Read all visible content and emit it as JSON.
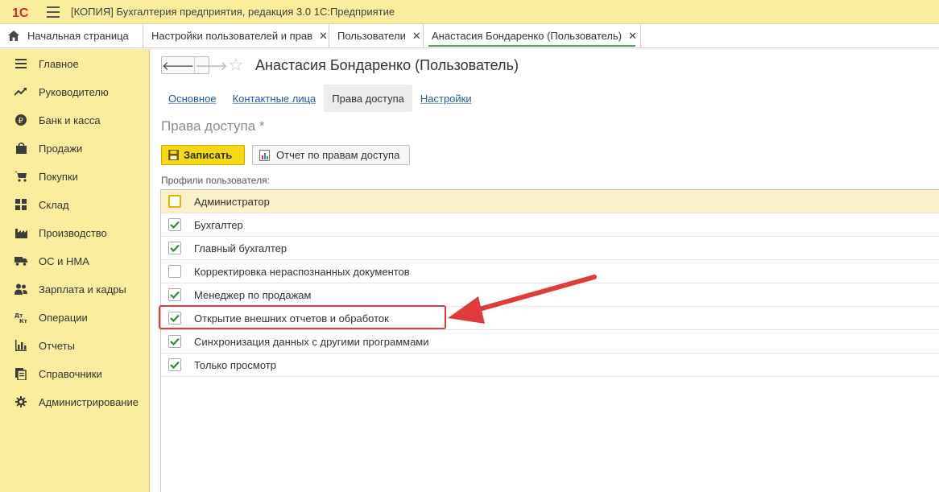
{
  "window": {
    "title": "[КОПИЯ] Бухгалтерия предприятия, редакция 3.0 1С:Предприятие",
    "logo_text": "1С"
  },
  "tabs": [
    {
      "label": "Начальная страница",
      "closable": false,
      "active": false
    },
    {
      "label": "Настройки пользователей и прав",
      "closable": true,
      "active": false
    },
    {
      "label": "Пользователи",
      "closable": true,
      "active": false
    },
    {
      "label": "Анастасия Бондаренко (Пользователь)",
      "closable": true,
      "active": true
    }
  ],
  "sidebar": {
    "items": [
      {
        "label": "Главное",
        "icon": "menu-lines-icon"
      },
      {
        "label": "Руководителю",
        "icon": "trend-icon"
      },
      {
        "label": "Банк и касса",
        "icon": "ruble-coin-icon"
      },
      {
        "label": "Продажи",
        "icon": "shopping-bag-icon"
      },
      {
        "label": "Покупки",
        "icon": "cart-icon"
      },
      {
        "label": "Склад",
        "icon": "warehouse-icon"
      },
      {
        "label": "Производство",
        "icon": "factory-icon"
      },
      {
        "label": "ОС и НМА",
        "icon": "truck-icon"
      },
      {
        "label": "Зарплата и кадры",
        "icon": "people-icon"
      },
      {
        "label": "Операции",
        "icon": "dt-kt-icon"
      },
      {
        "label": "Отчеты",
        "icon": "bar-chart-icon"
      },
      {
        "label": "Справочники",
        "icon": "books-icon"
      },
      {
        "label": "Администрирование",
        "icon": "gear-icon"
      }
    ]
  },
  "form": {
    "title": "Анастасия Бондаренко (Пользователь)",
    "subtabs": [
      {
        "label": "Основное",
        "active": false
      },
      {
        "label": "Контактные лица",
        "active": false
      },
      {
        "label": "Права доступа",
        "active": true
      },
      {
        "label": "Настройки",
        "active": false
      }
    ],
    "section_title": "Права доступа *",
    "save_button": "Записать",
    "report_button": "Отчет по правам доступа",
    "profiles_label": "Профили пользователя:",
    "profiles": [
      {
        "label": "Администратор",
        "checked": false,
        "selected": true
      },
      {
        "label": "Бухгалтер",
        "checked": true,
        "selected": false
      },
      {
        "label": "Главный бухгалтер",
        "checked": true,
        "selected": false
      },
      {
        "label": "Корректировка нераспознанных документов",
        "checked": false,
        "selected": false
      },
      {
        "label": "Менеджер по продажам",
        "checked": true,
        "selected": false
      },
      {
        "label": "Открытие внешних отчетов и обработок",
        "checked": true,
        "selected": false
      },
      {
        "label": "Синхронизация данных с другими программами",
        "checked": true,
        "selected": false
      },
      {
        "label": "Только просмотр",
        "checked": true,
        "selected": false
      }
    ]
  },
  "colors": {
    "header_bg": "#fbed9e",
    "sidebar_bg": "#fbed9e",
    "save_button_bg": "#f5d816",
    "check_green": "#2f8a3a",
    "annotation_red": "#e03b3b",
    "link_blue": "#1f5a9c"
  }
}
